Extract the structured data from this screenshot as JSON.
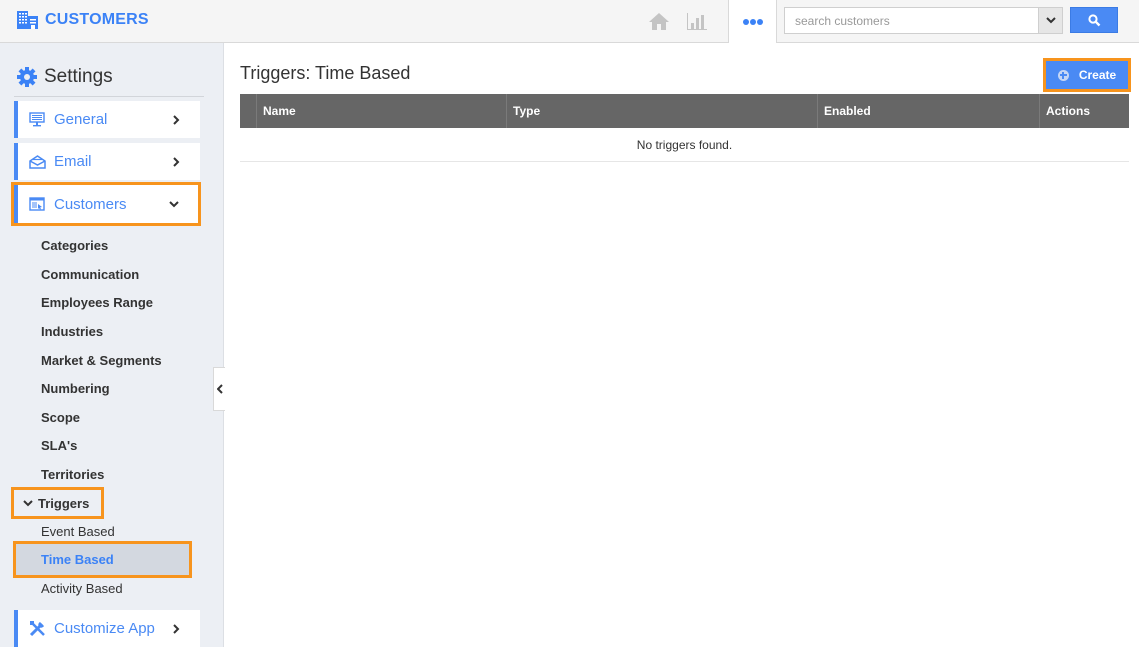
{
  "app": {
    "title": "CUSTOMERS",
    "icon": "building-icon",
    "accent_color": "#3b82f6",
    "highlight_color": "#f7941d"
  },
  "topbar": {
    "nav": [
      {
        "name": "home",
        "icon": "home-icon"
      },
      {
        "name": "reports",
        "icon": "bar-chart-icon"
      },
      {
        "name": "more",
        "icon": "more-dots-icon"
      }
    ],
    "search": {
      "value": "",
      "placeholder": "search customers",
      "dropdown_icon": "chevron-down-icon",
      "button_icon": "search-icon"
    }
  },
  "sidebar": {
    "title": "Settings",
    "title_icon": "gear-icon",
    "menu": [
      {
        "label": "General",
        "icon": "monitor-icon",
        "expanded": false
      },
      {
        "label": "Email",
        "icon": "envelope-icon",
        "expanded": false
      },
      {
        "label": "Customers",
        "icon": "window-icon",
        "expanded": true
      }
    ],
    "customers_sub": [
      "Categories",
      "Communication",
      "Employees Range",
      "Industries",
      "Market & Segments",
      "Numbering",
      "Scope",
      "SLA's",
      "Territories"
    ],
    "triggers": {
      "label": "Triggers",
      "expanded": true,
      "items": [
        "Event Based",
        "Time Based",
        "Activity Based"
      ],
      "active": "Time Based"
    },
    "customize": {
      "label": "Customize App",
      "icon": "tools-icon"
    }
  },
  "main": {
    "title": "Triggers: Time Based",
    "create_label": "Create",
    "table": {
      "columns": [
        "",
        "Name",
        "Type",
        "Enabled",
        "Actions"
      ],
      "empty_message": "No triggers found."
    }
  }
}
